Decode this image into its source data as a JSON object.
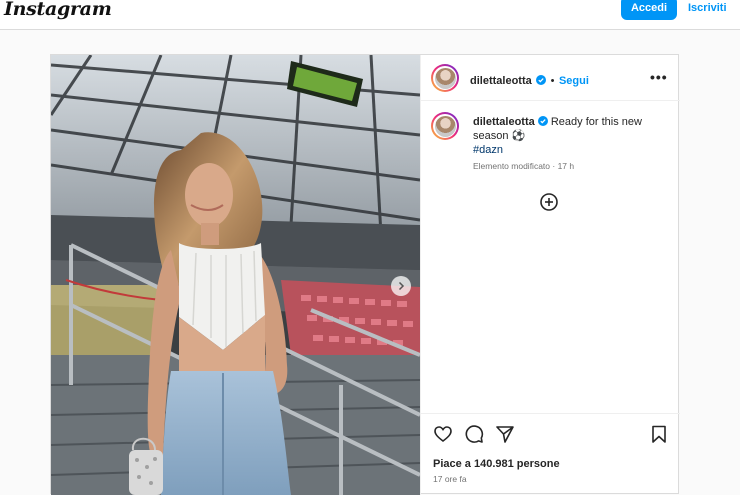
{
  "header": {
    "logo": "Instagram",
    "login_label": "Accedi",
    "signup_label": "Iscriviti"
  },
  "post": {
    "username": "dilettaleotta",
    "separator": "•",
    "follow_label": "Segui",
    "more_label": "•••",
    "caption_text": "Ready for this new season ⚽",
    "hashtag": "#dazn",
    "edited_meta": "Elemento modificato · 17 h",
    "likes": "Piace a 140.981 persone",
    "time_ago": "17 ore fa"
  },
  "colors": {
    "accent": "#0095f6",
    "verified": "#0095f6",
    "border": "#dbdbdb"
  },
  "icons": {
    "verified": "verified-badge-icon",
    "more": "more-options-icon",
    "add": "add-circle-icon",
    "like": "heart-icon",
    "comment": "comment-icon",
    "share": "send-icon",
    "save": "bookmark-icon",
    "next": "chevron-right-icon"
  }
}
